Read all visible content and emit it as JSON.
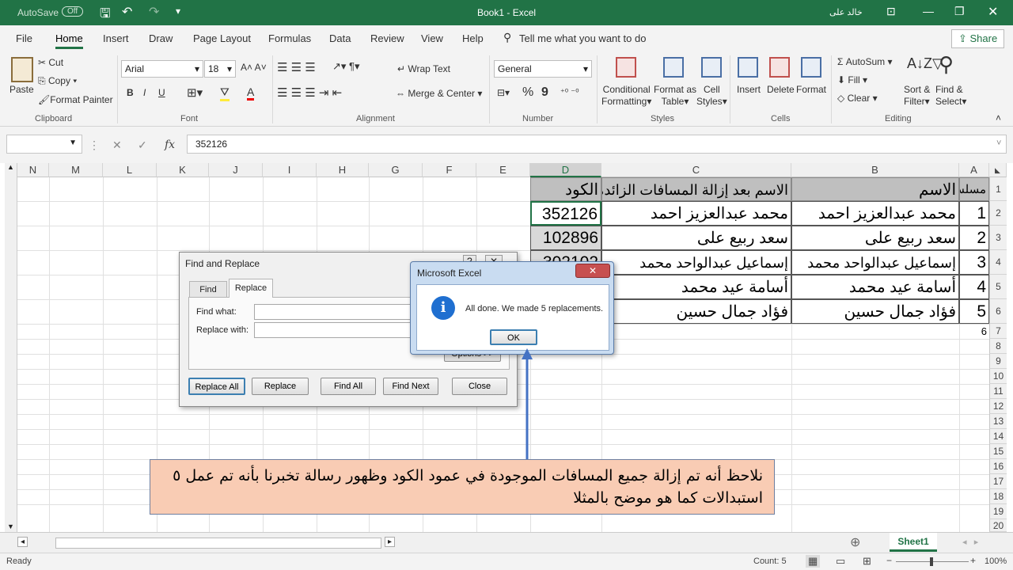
{
  "titlebar": {
    "autosave": "AutoSave",
    "autosave_state": "Off",
    "title": "Book1 - Excel",
    "user": "خالد على"
  },
  "menu": [
    "File",
    "Home",
    "Insert",
    "Draw",
    "Page Layout",
    "Formulas",
    "Data",
    "Review",
    "View",
    "Help"
  ],
  "tell_me": "Tell me what you want to do",
  "share": "Share",
  "ribbon": {
    "clipboard": {
      "paste": "Paste",
      "cut": "Cut",
      "copy": "Copy",
      "format_painter": "Format Painter",
      "group": "Clipboard"
    },
    "font": {
      "name": "Arial",
      "size": "18",
      "bold": "B",
      "italic": "I",
      "underline": "U",
      "group": "Font"
    },
    "alignment": {
      "wrap": "Wrap Text",
      "merge": "Merge & Center",
      "group": "Alignment"
    },
    "number": {
      "format": "General",
      "percent": "%",
      "comma": "9",
      "group": "Number"
    },
    "styles": {
      "conditional": [
        "Conditional",
        "Formatting"
      ],
      "format_as": [
        "Format as",
        "Table"
      ],
      "cell": [
        "Cell",
        "Styles"
      ],
      "group": "Styles"
    },
    "cells": {
      "insert": "Insert",
      "delete": "Delete",
      "format": "Format",
      "group": "Cells"
    },
    "editing": {
      "autosum": "AutoSum",
      "fill": "Fill",
      "clear": "Clear",
      "sort": [
        "Sort &",
        "Filter"
      ],
      "find": [
        "Find &",
        "Select"
      ],
      "group": "Editing"
    }
  },
  "formula_bar": {
    "fx": "fx",
    "value": "352126"
  },
  "columns": [
    "N",
    "M",
    "L",
    "K",
    "J",
    "I",
    "H",
    "G",
    "F",
    "E",
    "D",
    "C",
    "B",
    "A"
  ],
  "rows": [
    "1",
    "2",
    "3",
    "4",
    "5",
    "6",
    "7",
    "8",
    "9",
    "10",
    "11",
    "12",
    "13",
    "14",
    "15",
    "16",
    "17",
    "18",
    "19",
    "20"
  ],
  "table": {
    "headers": {
      "a": "مسلسل",
      "b": "الاسم",
      "c": "الاسم بعد إزالة المسافات الزائدة",
      "d": "الكود"
    },
    "rows": [
      {
        "a": "1",
        "b": "محمد عبدالعزيز احمد",
        "c": "محمد عبدالعزيز احمد",
        "d": "352126"
      },
      {
        "a": "2",
        "b": "سعد ربيع  على",
        "c": "سعد ربيع على",
        "d": "102896"
      },
      {
        "a": "3",
        "b": "إسماعيل  عبدالواحد   محمد",
        "c": "إسماعيل عبدالواحد محمد",
        "d": "302102"
      },
      {
        "a": "4",
        "b": "أسامة عيد  محمد",
        "c": "أسامة عيد محمد",
        "d": ""
      },
      {
        "a": "5",
        "b": "فؤاد جمال حسين",
        "c": "فؤاد جمال حسين",
        "d": ""
      }
    ],
    "a7": "6"
  },
  "find_replace": {
    "title": "Find and Replace",
    "tab_find": "Find",
    "tab_replace": "Replace",
    "find_what": "Find what:",
    "replace_with": "Replace with:",
    "options": "Options >>",
    "replace_all": "Replace All",
    "replace": "Replace",
    "find_all": "Find All",
    "find_next": "Find Next",
    "close": "Close"
  },
  "msgbox": {
    "title": "Microsoft Excel",
    "message": "All done. We made 5 replacements.",
    "ok": "OK"
  },
  "note": "نلاحظ أنه تم إزالة جميع المسافات الموجودة في عمود الكود وظهور رسالة تخبرنا بأنه تم عمل ٥ استبدالات كما هو موضح بالمثلا",
  "sheet": "Sheet1",
  "status": {
    "ready": "Ready",
    "count": "Count: 5",
    "zoom": "100%"
  },
  "colors": {
    "excel_green": "#217346",
    "note_bg": "#f9ccb4",
    "header_cell": "#bfbfbf",
    "arrow": "#4472c4"
  }
}
